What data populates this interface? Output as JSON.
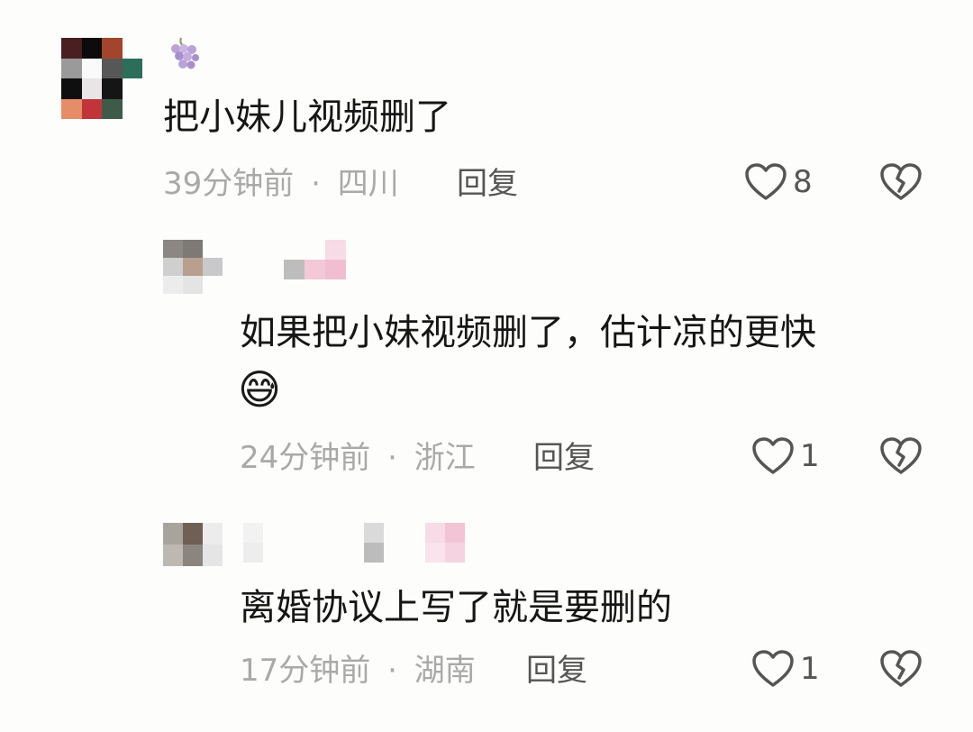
{
  "comments": [
    {
      "username_icon": "grape-emoji",
      "text": "把小妹儿视频删了",
      "time": "39分钟前",
      "separator": "·",
      "location": "四川",
      "reply_label": "回复",
      "likes": "8"
    },
    {
      "text": "如果把小妹视频删了，估计凉的更快",
      "emoji": "😅",
      "time": "24分钟前",
      "separator": "·",
      "location": "浙江",
      "reply_label": "回复",
      "likes": "1"
    },
    {
      "text": "离婚协议上写了就是要删的",
      "time": "17分钟前",
      "separator": "·",
      "location": "湖南",
      "reply_label": "回复",
      "likes": "1"
    }
  ],
  "icons": {
    "like": "heart-outline-icon",
    "dislike": "broken-heart-icon"
  },
  "colors": {
    "background": "#fdfdfb",
    "text": "#161616",
    "meta": "#a9a9a9",
    "action": "#555555"
  }
}
